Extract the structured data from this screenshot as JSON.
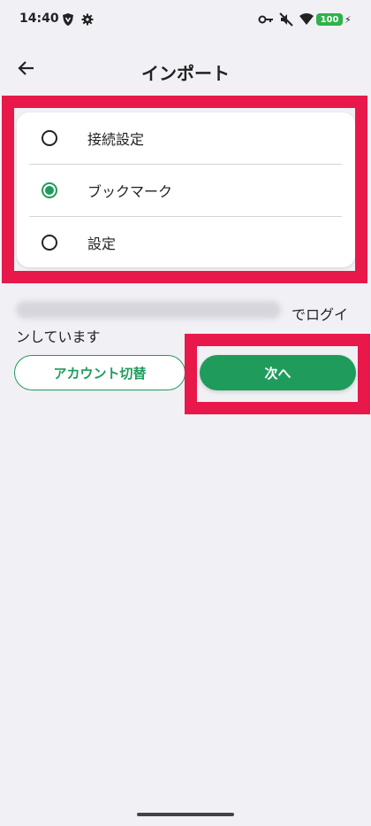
{
  "status_bar": {
    "time": "14:40",
    "battery": "100",
    "icons": [
      "shield-icon",
      "gear-icon",
      "key-icon",
      "mute-icon",
      "wifi-icon",
      "battery-icon",
      "charging-icon"
    ]
  },
  "header": {
    "title": "インポート",
    "back_icon": "arrow-left-icon"
  },
  "options": [
    {
      "label": "接続設定",
      "selected": false
    },
    {
      "label": "ブックマーク",
      "selected": true
    },
    {
      "label": "設定",
      "selected": false
    }
  ],
  "login": {
    "email_masked": "",
    "suffix": "でログイ",
    "line2": "ンしています"
  },
  "buttons": {
    "switch_account": "アカウント切替",
    "next": "次へ"
  },
  "colors": {
    "accent": "#1f9c5c",
    "highlight": "#e8194a",
    "background": "#f1f0f5"
  }
}
